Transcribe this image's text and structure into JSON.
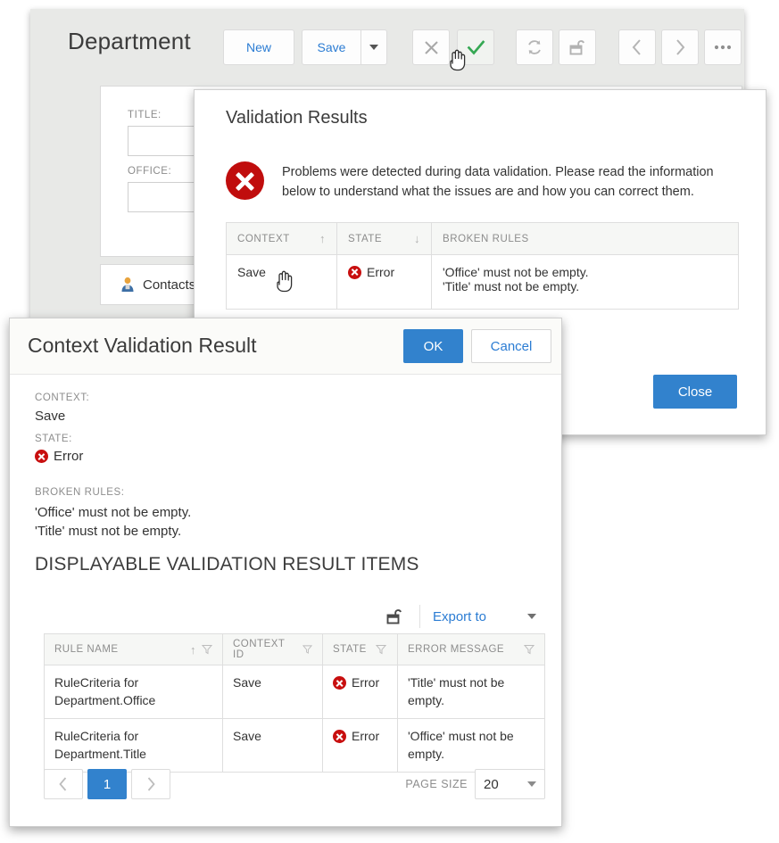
{
  "app": {
    "title": "Department",
    "toolbar": {
      "new_label": "New",
      "save_label": "Save",
      "icons": [
        {
          "name": "cancel-icon",
          "glyph": "✕"
        },
        {
          "name": "ok-check-icon",
          "glyph": "✓"
        },
        {
          "name": "refresh-icon",
          "glyph": "↻"
        },
        {
          "name": "unlock-icon",
          "glyph": "⬚"
        },
        {
          "name": "previous-icon",
          "glyph": "‹"
        },
        {
          "name": "next-icon",
          "glyph": "›"
        },
        {
          "name": "more-icon",
          "glyph": "•••"
        }
      ]
    },
    "form": {
      "title_label": "TITLE:",
      "title_value": "",
      "office_label": "OFFICE:",
      "office_value": ""
    },
    "tabs": [
      {
        "label": "Contacts",
        "icon": "contact-person-icon"
      }
    ]
  },
  "validation_dialog": {
    "title": "Validation Results",
    "message": "Problems were detected during data validation. Please read the information below to understand what the issues are and how you can correct them.",
    "error_icon": "error-circle-icon",
    "table": {
      "columns": [
        {
          "label": "CONTEXT",
          "sort": "↑"
        },
        {
          "label": "STATE",
          "sort": "↓"
        },
        {
          "label": "BROKEN RULES",
          "sort": ""
        }
      ],
      "rows": [
        {
          "context": "Save",
          "state": "Error",
          "broken_rules": "'Office' must not be empty.\n'Title' must not be empty."
        }
      ]
    },
    "close_label": "Close"
  },
  "context_dialog": {
    "title": "Context Validation Result",
    "ok_label": "OK",
    "cancel_label": "Cancel",
    "context_label": "CONTEXT:",
    "context_value": "Save",
    "state_label": "STATE:",
    "state_value": "Error",
    "rules_label": "BROKEN RULES:",
    "rules_value": "'Office' must not be empty.\n'Title' must not be empty.",
    "section_title": "DISPLAYABLE VALIDATION RESULT ITEMS",
    "grid_toolbar": {
      "unlock_icon": "unlock-icon",
      "export_label": "Export to"
    },
    "grid": {
      "columns": [
        {
          "label": "RULE NAME",
          "sort": "↑",
          "filter": true
        },
        {
          "label": "CONTEXT ID",
          "sort": "",
          "filter": true
        },
        {
          "label": "STATE",
          "sort": "",
          "filter": true
        },
        {
          "label": "ERROR MESSAGE",
          "sort": "",
          "filter": true
        }
      ],
      "rows": [
        {
          "rule_name": "RuleCriteria for Department.Office",
          "context_id": "Save",
          "state": "Error",
          "error_message": "'Title' must not be empty."
        },
        {
          "rule_name": "RuleCriteria for Department.Title",
          "context_id": "Save",
          "state": "Error",
          "error_message": "'Office' must not be empty."
        }
      ]
    },
    "pager": {
      "prev_label": "‹",
      "current_page": "1",
      "next_label": "›",
      "page_size_label": "PAGE SIZE",
      "page_size_value": "20"
    }
  },
  "colors": {
    "accent": "#3282cd",
    "link": "#2b7cd3",
    "error": "#c80f0f",
    "ok_check": "#3aa655",
    "panel_bg": "#e8e9e7"
  }
}
